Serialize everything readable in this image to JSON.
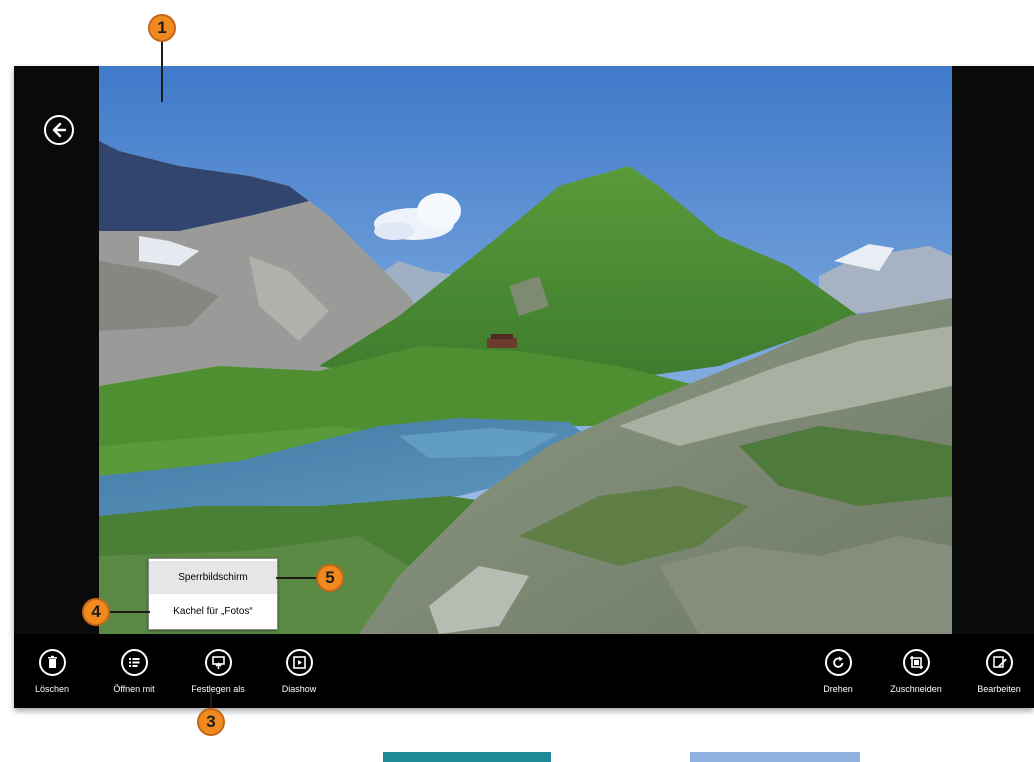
{
  "back": {
    "icon": "back-arrow-icon"
  },
  "appbar": {
    "left": [
      {
        "label": "Löschen",
        "icon": "trash-icon"
      },
      {
        "label": "Öffnen mit",
        "icon": "open-with-icon"
      },
      {
        "label": "Festlegen als",
        "icon": "set-as-icon"
      },
      {
        "label": "Diashow",
        "icon": "slideshow-icon"
      }
    ],
    "right": [
      {
        "label": "Drehen",
        "icon": "rotate-icon"
      },
      {
        "label": "Zuschneiden",
        "icon": "crop-icon"
      },
      {
        "label": "Bearbeiten",
        "icon": "edit-icon"
      }
    ]
  },
  "context_menu": {
    "items": [
      {
        "label": "Sperrbildschirm"
      },
      {
        "label": "Kachel für „Fotos“"
      }
    ]
  },
  "callouts": [
    "1",
    "3",
    "4",
    "5"
  ],
  "colors": {
    "callout_fill": "#f08a1f",
    "appbar_bg": "#000000",
    "tile_teal": "#1f8a96",
    "tile_blue": "#8fb3e0"
  }
}
